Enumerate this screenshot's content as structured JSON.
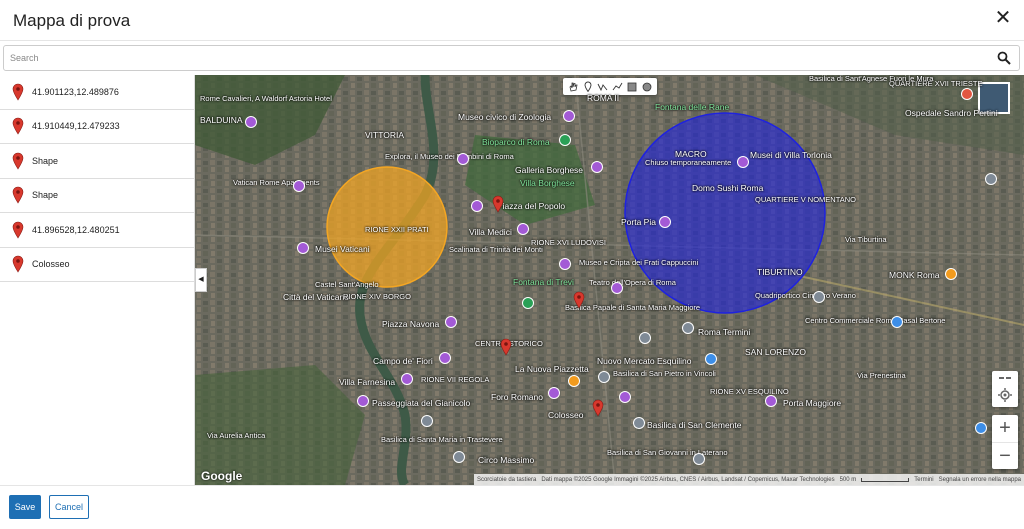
{
  "dialog": {
    "title": "Mappa di prova"
  },
  "search": {
    "placeholder": "Search",
    "value": ""
  },
  "sidebar": {
    "items": [
      {
        "label": "41.901123,12.489876",
        "icon": "red-map-pin-icon"
      },
      {
        "label": "41.910449,12.479233",
        "icon": "red-map-pin-icon"
      },
      {
        "label": "Shape",
        "icon": "red-map-pin-icon"
      },
      {
        "label": "Shape",
        "icon": "red-map-pin-icon"
      },
      {
        "label": "41.896528,12.480251",
        "icon": "red-map-pin-icon"
      },
      {
        "label": "Colosseo",
        "icon": "red-map-pin-icon"
      }
    ]
  },
  "map": {
    "labels": [
      "Rome Cavalieri, A Waldorf Astoria Hotel",
      "BALDUINA",
      "VITTORIA",
      "Museo civico di Zoologia",
      "Bioparco di Roma",
      "Fontana delle Rane",
      "QUARTIERE XVII TRIESTE",
      "Basilica di Sant'Agnese Fuori le Mura",
      "Ospedale Sandro Pertini",
      "ROMA II",
      "Explora, il Museo dei Bambini di Roma",
      "Galleria Borghese",
      "Villa Borghese",
      "MACRO",
      "Musei di Villa Torlonia",
      "Chiuso temporaneamente",
      "Domo Sushi Roma",
      "Vatican Rome Apartments",
      "Piazza del Popolo",
      "Porta Pia",
      "QUARTIERE V NOMENTANO",
      "RIONE XXII PRATI",
      "Musei Vaticani",
      "Villa Medici",
      "Scalinata di Trinità dei Monti",
      "RIONE XVI LUDOVISI",
      "Museo e Cripta dei Frati Cappuccini",
      "Via Tiburtina",
      "TIBURTINO",
      "MONK Roma",
      "Città del Vaticano",
      "Castel Sant'Angelo",
      "RIONE XIV BORGO",
      "Fontana di Trevi",
      "Teatro dell'Opera di Roma",
      "Quadriportico Cimitero Verano",
      "Piazza Navona",
      "Basilica Papale di Santa Maria Maggiore",
      "Roma Termini",
      "Centro Commerciale Roma Casal Bertone",
      "CENTRO STORICO",
      "Campo de' Fiori",
      "Nuovo Mercato Esquilino",
      "SAN LORENZO",
      "Villa Farnesina",
      "RIONE VII REGOLA",
      "La Nuova Piazzetta",
      "Basilica di San Pietro in Vincoli",
      "Foro Romano",
      "RIONE XV ESQUILINO",
      "Porta Maggiore",
      "Passeggiata del Gianicolo",
      "Colosseo",
      "Basilica di San Clemente",
      "Via Aurelia Antica",
      "Basilica di Santa Maria in Trastevere",
      "Circo Massimo",
      "Basilica di San Giovanni in Laterano",
      "Via Prenestina"
    ],
    "attribution": {
      "shortcuts": "Scorciatoie da tastiera",
      "data": "Dati mappa ©2025 Google Immagini ©2025 Airbus, CNES / Airbus, Landsat / Copernicus, Maxar Technologies",
      "scale": "500 m",
      "terms": "Termini",
      "report": "Segnala un errore nella mappa"
    },
    "logo": "Google",
    "zoom_in": "+",
    "zoom_out": "−",
    "circles": [
      {
        "name": "orange-circle-shape",
        "color": "#f4a623"
      },
      {
        "name": "blue-circle-shape",
        "color": "#1e22e0"
      }
    ]
  },
  "footer": {
    "save_label": "Save",
    "cancel_label": "Cancel"
  },
  "colors": {
    "accent": "#1e6fb4",
    "pin": "#d8382d"
  }
}
